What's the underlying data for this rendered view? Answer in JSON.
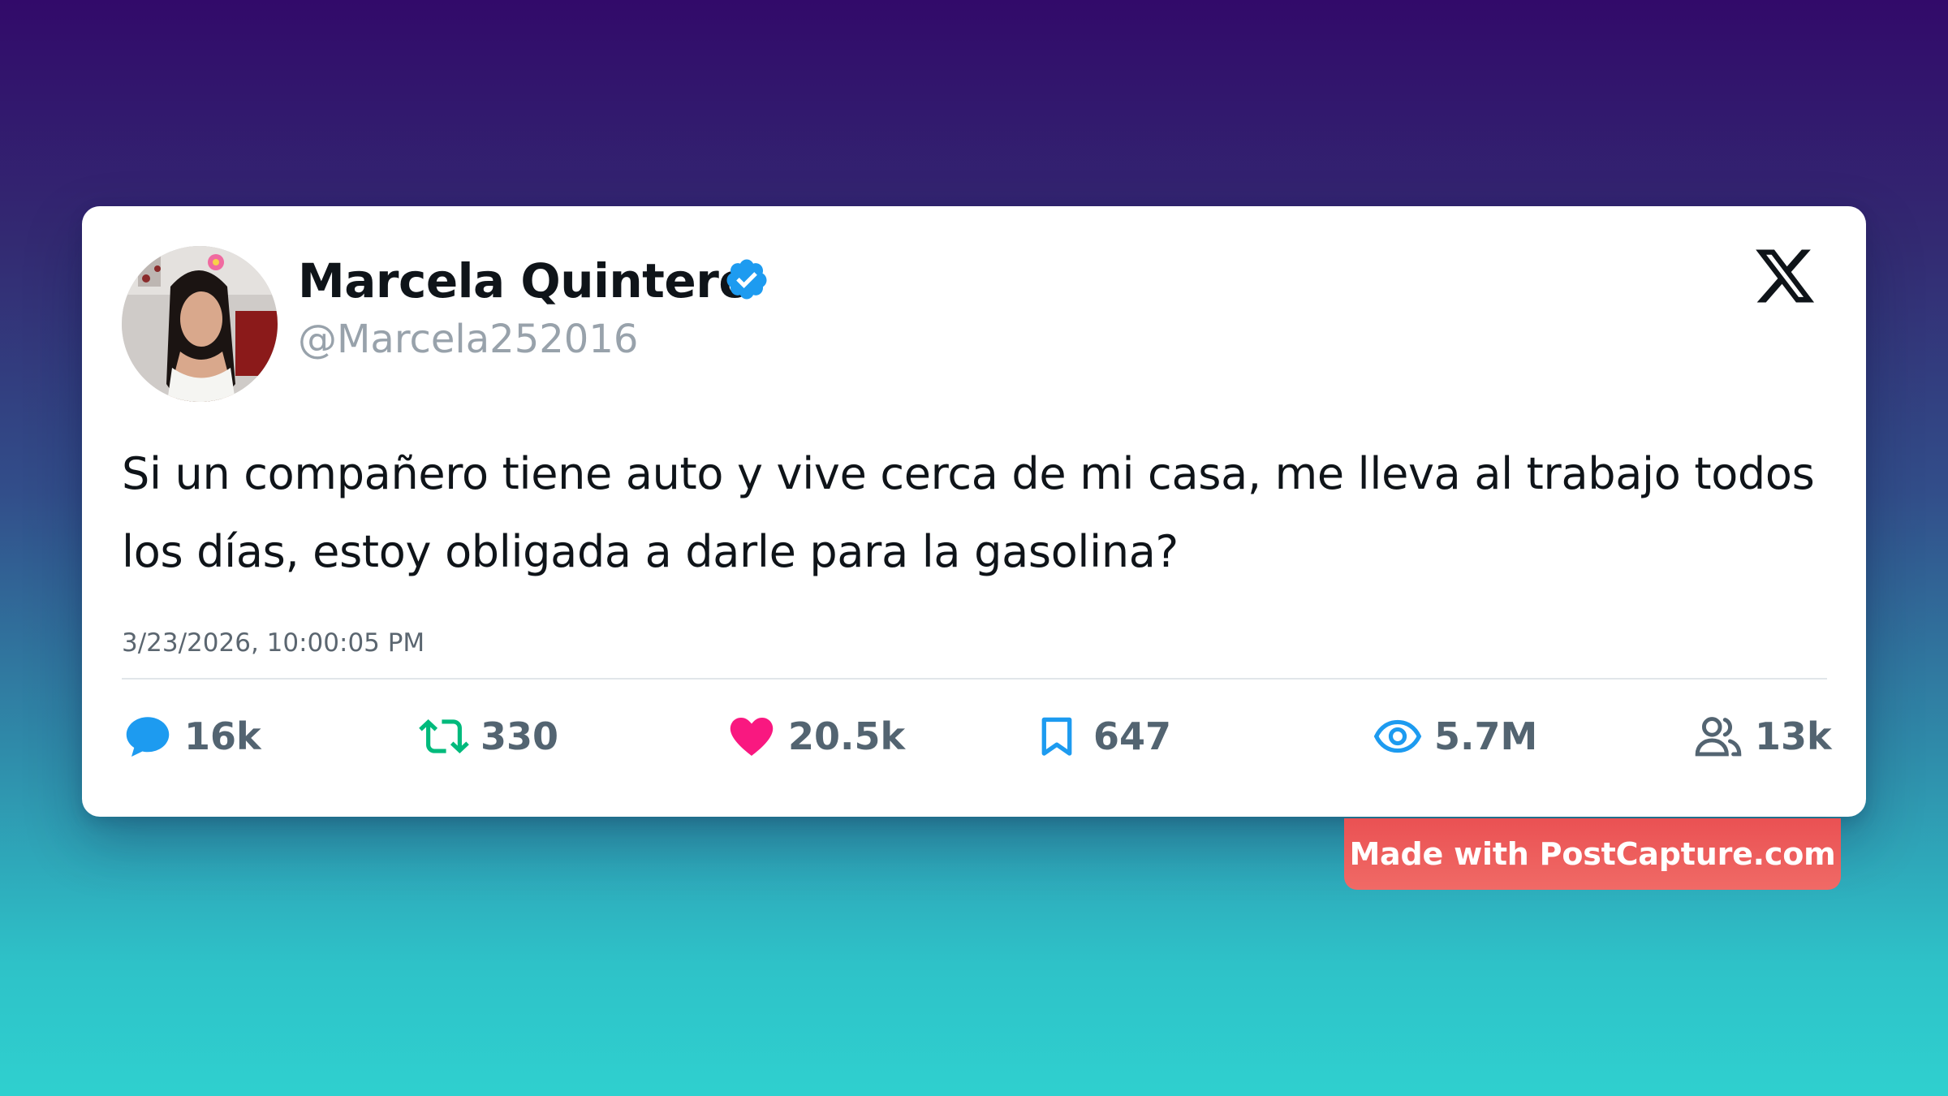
{
  "tweet": {
    "display_name": "Marcela Quintero",
    "handle": "@Marcela252016",
    "verified": true,
    "text": "Si un compañero tiene auto y vive cerca de mi casa, me lleva al trabajo todos los días, estoy obligada a darle para la gasolina?",
    "timestamp": "3/23/2026, 10:00:05 PM",
    "platform_icon": "x-logo-icon"
  },
  "stats": {
    "replies": "16k",
    "reposts": "330",
    "likes": "20.5k",
    "bookmarks": "647",
    "views": "5.7M",
    "followers": "13k"
  },
  "icons": {
    "replies": "comment-icon",
    "reposts": "repost-icon",
    "likes": "heart-icon",
    "bookmarks": "bookmark-icon",
    "views": "eye-icon",
    "followers": "people-icon"
  },
  "colors": {
    "reply_blue": "#1d9bf0",
    "repost_green": "#00ba7c",
    "like_pink": "#f91880",
    "verified_blue": "#1d9bf0",
    "badge_red": "#ea5153"
  },
  "watermark": {
    "label": "Made with PostCapture.com"
  }
}
